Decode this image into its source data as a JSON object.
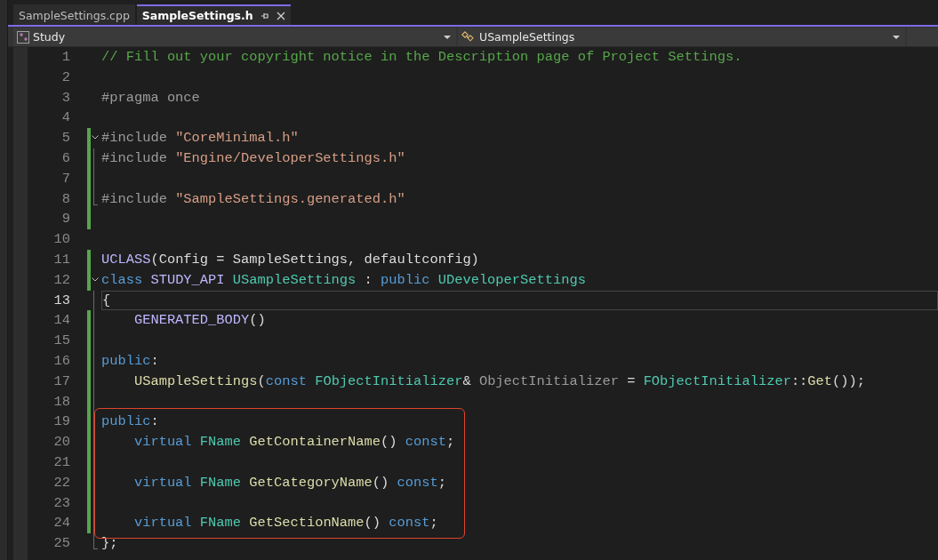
{
  "tabs": [
    {
      "label": "SampleSettings.cpp",
      "selected": false
    },
    {
      "label": "SampleSettings.h",
      "selected": true
    }
  ],
  "navigation": {
    "project": "Study",
    "member": "USampleSettings"
  },
  "lines": [
    {
      "number": "1",
      "changed": false,
      "current": false,
      "boxed": false,
      "code": [
        {
          "text": "// Fill out your copyright notice in the Description page of Project Settings.",
          "kind": "comment"
        }
      ]
    },
    {
      "number": "2",
      "changed": false,
      "current": false,
      "boxed": false
    },
    {
      "number": "3",
      "changed": false,
      "current": false,
      "boxed": false,
      "code": [
        {
          "text": "#pragma once",
          "kind": "preproc"
        }
      ]
    },
    {
      "number": "4",
      "changed": false,
      "current": false,
      "boxed": false
    },
    {
      "number": "5",
      "changed": true,
      "current": false,
      "boxed": false,
      "kind": "opener",
      "code": [
        {
          "text": "#include ",
          "kind": "preproc"
        },
        {
          "text": "\"CoreMinimal.h\"",
          "kind": "string"
        }
      ]
    },
    {
      "number": "6",
      "changed": true,
      "current": false,
      "boxed": false,
      "kind": "inner",
      "code": [
        {
          "text": "#include ",
          "kind": "preproc"
        },
        {
          "text": "\"Engine/DeveloperSettings.h\"",
          "kind": "string"
        }
      ]
    },
    {
      "number": "7",
      "changed": true,
      "current": false,
      "boxed": false,
      "kind": "inner"
    },
    {
      "number": "8",
      "changed": true,
      "current": false,
      "boxed": false,
      "kind": "closer",
      "code": [
        {
          "text": "#include ",
          "kind": "preproc"
        },
        {
          "text": "\"SampleSettings.generated.h\"",
          "kind": "string"
        }
      ]
    },
    {
      "number": "9",
      "changed": true,
      "current": false,
      "boxed": false
    },
    {
      "number": "10",
      "changed": false,
      "current": false,
      "boxed": false
    },
    {
      "number": "11",
      "changed": true,
      "current": false,
      "boxed": false,
      "code": [
        {
          "text": "UCLASS",
          "kind": "macro"
        },
        {
          "text": "(Config = SampleSettings, defaultconfig)",
          "kind": "plain"
        }
      ]
    },
    {
      "number": "12",
      "changed": true,
      "current": false,
      "boxed": false,
      "kind": "opener",
      "code": [
        {
          "text": "class ",
          "kind": "keyword"
        },
        {
          "text": "STUDY_API ",
          "kind": "macro"
        },
        {
          "text": "USampleSettings",
          "kind": "type"
        },
        {
          "text": " : ",
          "kind": "plain"
        },
        {
          "text": "public ",
          "kind": "keyword"
        },
        {
          "text": "UDeveloperSettings",
          "kind": "type"
        }
      ]
    },
    {
      "number": "13",
      "changed": false,
      "current": true,
      "boxed": false,
      "kind": "inner",
      "code": [
        {
          "text": "{",
          "kind": "plain"
        }
      ]
    },
    {
      "number": "14",
      "changed": true,
      "current": false,
      "boxed": false,
      "kind": "inner",
      "code": [
        {
          "text": "    GENERATED_BODY",
          "kind": "macro"
        },
        {
          "text": "()",
          "kind": "plain"
        }
      ]
    },
    {
      "number": "15",
      "changed": true,
      "current": false,
      "boxed": false,
      "kind": "inner"
    },
    {
      "number": "16",
      "changed": true,
      "current": false,
      "boxed": false,
      "kind": "inner",
      "code": [
        {
          "text": "public",
          "kind": "keyword"
        },
        {
          "text": ":",
          "kind": "plain"
        }
      ]
    },
    {
      "number": "17",
      "changed": true,
      "current": false,
      "boxed": false,
      "kind": "inner",
      "code": [
        {
          "text": "    USampleSettings",
          "kind": "func"
        },
        {
          "text": "(",
          "kind": "plain"
        },
        {
          "text": "const ",
          "kind": "keyword"
        },
        {
          "text": "FObjectInitializer",
          "kind": "type"
        },
        {
          "text": "& ",
          "kind": "plain"
        },
        {
          "text": "ObjectInitializer",
          "kind": "param"
        },
        {
          "text": " = ",
          "kind": "plain"
        },
        {
          "text": "FObjectInitializer",
          "kind": "type"
        },
        {
          "text": "::",
          "kind": "plain"
        },
        {
          "text": "Get",
          "kind": "func"
        },
        {
          "text": "());",
          "kind": "plain"
        }
      ]
    },
    {
      "number": "18",
      "changed": true,
      "current": false,
      "boxed": false,
      "kind": "inner"
    },
    {
      "number": "19",
      "changed": true,
      "current": false,
      "boxed": true,
      "kind": "inner",
      "code": [
        {
          "text": "public",
          "kind": "keyword"
        },
        {
          "text": ":",
          "kind": "plain"
        }
      ]
    },
    {
      "number": "20",
      "changed": true,
      "current": false,
      "boxed": true,
      "kind": "inner",
      "code": [
        {
          "text": "    virtual ",
          "kind": "keyword"
        },
        {
          "text": "FName ",
          "kind": "type"
        },
        {
          "text": "GetContainerName",
          "kind": "func"
        },
        {
          "text": "() ",
          "kind": "plain"
        },
        {
          "text": "const",
          "kind": "keyword"
        },
        {
          "text": ";",
          "kind": "plain"
        }
      ]
    },
    {
      "number": "21",
      "changed": true,
      "current": false,
      "boxed": true,
      "kind": "inner"
    },
    {
      "number": "22",
      "changed": true,
      "current": false,
      "boxed": true,
      "kind": "inner",
      "code": [
        {
          "text": "    virtual ",
          "kind": "keyword"
        },
        {
          "text": "FName ",
          "kind": "type"
        },
        {
          "text": "GetCategoryName",
          "kind": "func"
        },
        {
          "text": "() ",
          "kind": "plain"
        },
        {
          "text": "const",
          "kind": "keyword"
        },
        {
          "text": ";",
          "kind": "plain"
        }
      ]
    },
    {
      "number": "23",
      "changed": true,
      "current": false,
      "boxed": true,
      "kind": "inner"
    },
    {
      "number": "24",
      "changed": true,
      "current": false,
      "boxed": true,
      "kind": "inner",
      "code": [
        {
          "text": "    virtual ",
          "kind": "keyword"
        },
        {
          "text": "FName ",
          "kind": "type"
        },
        {
          "text": "GetSectionName",
          "kind": "func"
        },
        {
          "text": "() ",
          "kind": "plain"
        },
        {
          "text": "const",
          "kind": "keyword"
        },
        {
          "text": ";",
          "kind": "plain"
        }
      ]
    },
    {
      "number": "25",
      "changed": false,
      "current": false,
      "boxed": false,
      "kind": "closer",
      "code": [
        {
          "text": "};",
          "kind": "plain"
        }
      ]
    }
  ]
}
